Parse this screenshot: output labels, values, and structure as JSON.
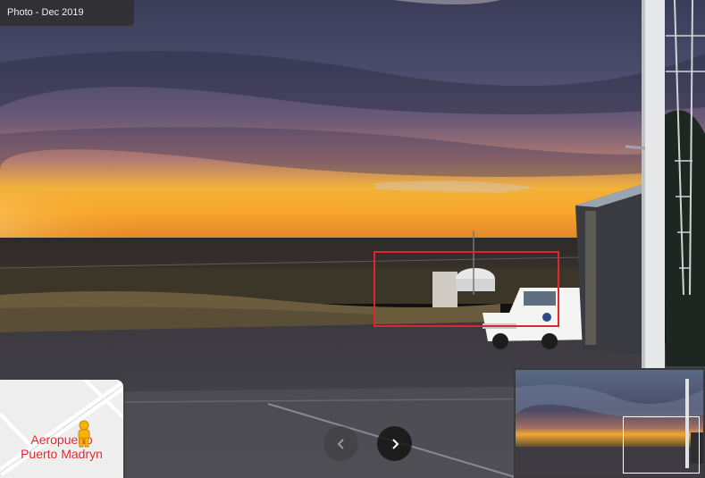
{
  "photo_info": {
    "date_label": "Photo - Dec 2019"
  },
  "location_card": {
    "name_line1": "Aeropuerto",
    "name_line2": "Puerto Madryn",
    "pin_icon": "pegman-icon"
  },
  "navigation": {
    "prev_icon": "chevron-left-icon",
    "next_icon": "chevron-right-icon"
  },
  "colors": {
    "highlight": "#e0262b",
    "sky_dark": "#3b3f5c",
    "sunset": "#f5a623"
  }
}
